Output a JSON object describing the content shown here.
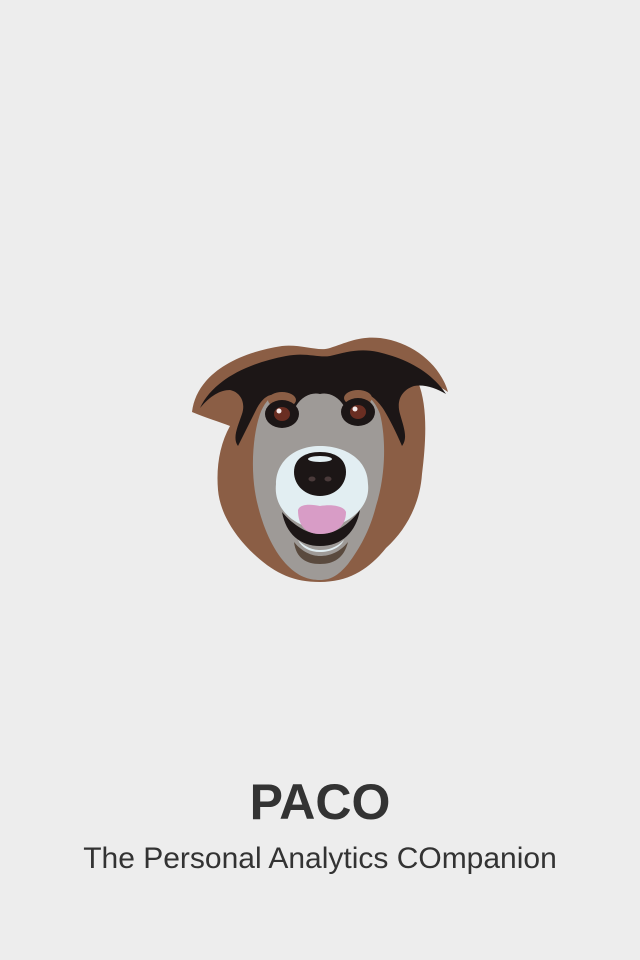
{
  "splash": {
    "title": "PACO",
    "subtitle": "The Personal Analytics COmpanion",
    "logo_icon": "dog-face-icon"
  },
  "colors": {
    "background": "#ededed",
    "text": "#333333",
    "fur_brown": "#8b5e45",
    "fur_black": "#1c1616",
    "fur_gray": "#9e9a97",
    "muzzle_white": "#e2eef2",
    "tongue_pink": "#d89cc6"
  }
}
